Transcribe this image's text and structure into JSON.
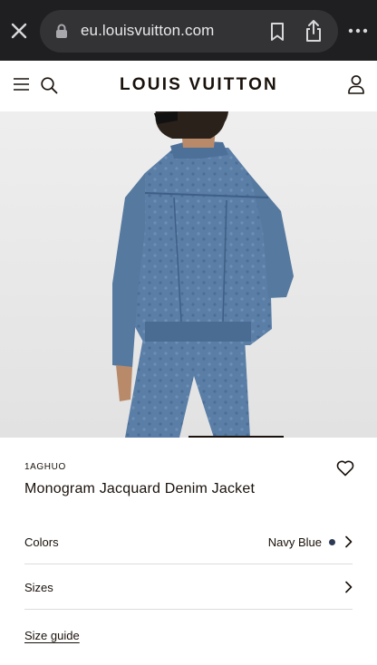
{
  "browser": {
    "url": "eu.louisvuitton.com",
    "icons": [
      "close-icon",
      "lock-icon",
      "bookmark-icon",
      "share-icon",
      "more-icon"
    ]
  },
  "header": {
    "logo": "LOUIS VUITTON",
    "icons": [
      "menu-icon",
      "search-icon",
      "account-icon"
    ]
  },
  "product": {
    "sku": "1AGHUO",
    "name": "Monogram Jacquard Denim Jacket",
    "image_alt": "Model wearing denim jacket, back view"
  },
  "options": {
    "colors_label": "Colors",
    "colors_value": "Navy Blue",
    "color_swatch": "#2d3a55",
    "sizes_label": "Sizes"
  },
  "links": {
    "size_guide": "Size guide"
  }
}
